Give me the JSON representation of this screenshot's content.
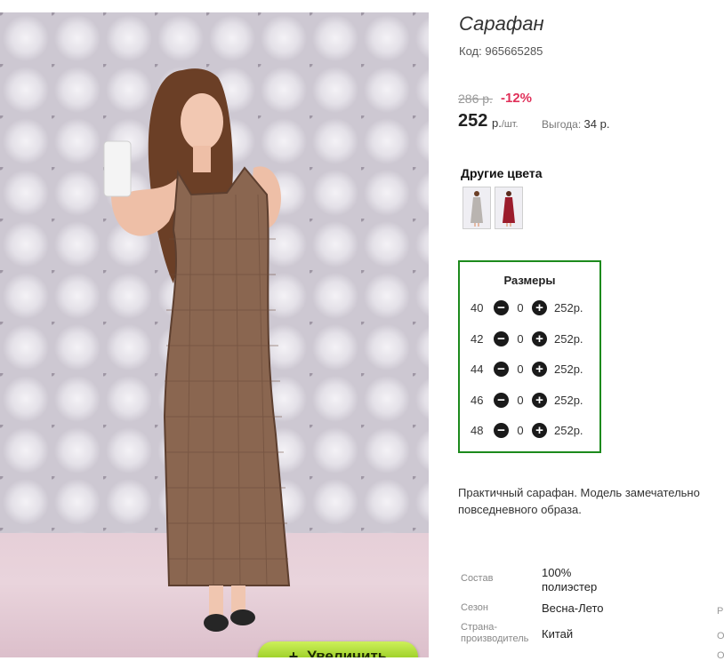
{
  "product": {
    "title": "Сарафан",
    "code_label": "Код:",
    "code_value": "965665285",
    "old_price": "286 р.",
    "discount": "-12%",
    "price": "252",
    "price_unit": "р.",
    "price_per": "/шт.",
    "savings_label": "Выгода:",
    "savings_value": "34 р."
  },
  "gallery": {
    "zoom_label": "Увеличить",
    "zoom_icon": "plus-icon"
  },
  "colors": {
    "title": "Другие цвета",
    "swatches": [
      "grey-dress-thumbnail",
      "red-dress-thumbnail"
    ]
  },
  "sizes": {
    "title": "Размеры",
    "rows": [
      {
        "size": "40",
        "qty": "0",
        "price": "252р."
      },
      {
        "size": "42",
        "qty": "0",
        "price": "252р."
      },
      {
        "size": "44",
        "qty": "0",
        "price": "252р."
      },
      {
        "size": "46",
        "qty": "0",
        "price": "252р."
      },
      {
        "size": "48",
        "qty": "0",
        "price": "252р."
      }
    ],
    "minus_symbol": "−",
    "plus_symbol": "+",
    "border_color": "#1c8a1c"
  },
  "description": {
    "line1": "Практичный сарафан. Модель замечательно",
    "line2": "повседневного образа."
  },
  "specs": [
    {
      "label": "Состав",
      "value_line1": "100%",
      "value_line2": "полиэстер"
    },
    {
      "label": "Сезон",
      "value_line1": "Весна-Лето"
    },
    {
      "label_line1": "Страна-",
      "label_line2": "производитель",
      "value_line1": "Китай"
    }
  ],
  "edge_text": [
    "Р",
    "О",
    "О"
  ]
}
